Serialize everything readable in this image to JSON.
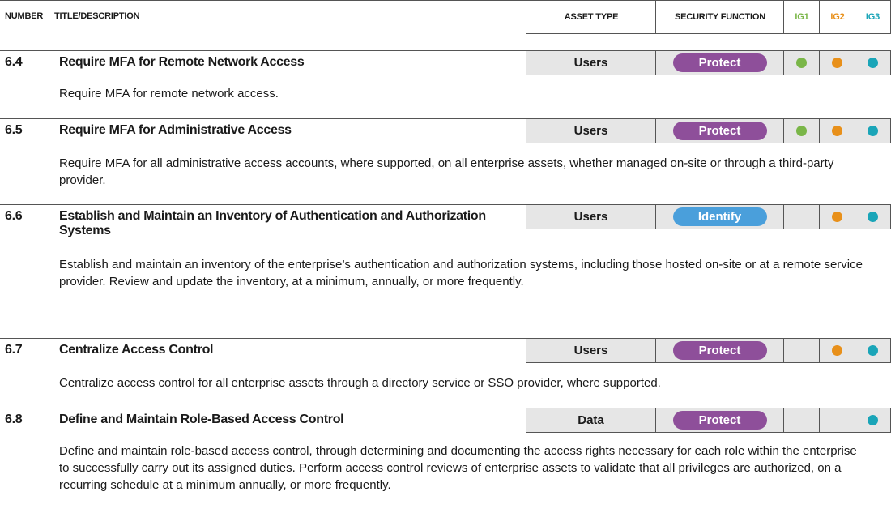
{
  "header": {
    "number": "NUMBER",
    "title": "TITLE/DESCRIPTION",
    "asset_type": "ASSET TYPE",
    "security_function": "SECURITY FUNCTION",
    "ig1": "IG1",
    "ig2": "IG2",
    "ig3": "IG3"
  },
  "colors": {
    "ig1": "#7ab648",
    "ig2": "#e8901a",
    "ig3": "#1aa5b8",
    "protect": "#8e4f9a",
    "identify": "#4a9fdb"
  },
  "controls": [
    {
      "number": "6.4",
      "title": "Require MFA for Remote Network Access",
      "asset_type": "Users",
      "security_function": "Protect",
      "function_color": "#8e4f9a",
      "ig1": true,
      "ig2": true,
      "ig3": true,
      "description": "Require MFA for remote network access."
    },
    {
      "number": "6.5",
      "title": "Require MFA for Administrative Access",
      "asset_type": "Users",
      "security_function": "Protect",
      "function_color": "#8e4f9a",
      "ig1": true,
      "ig2": true,
      "ig3": true,
      "description": "Require MFA for all administrative access accounts, where supported, on all enterprise assets, whether managed on-site or through a third-party provider."
    },
    {
      "number": "6.6",
      "title": "Establish and Maintain an Inventory of Authentication and Authorization Systems",
      "asset_type": "Users",
      "security_function": "Identify",
      "function_color": "#4a9fdb",
      "ig1": false,
      "ig2": true,
      "ig3": true,
      "description": "Establish and maintain an inventory of the enterprise’s authentication and authorization systems, including those hosted on-site or at a remote service provider. Review and update the inventory, at a minimum, annually, or more frequently."
    },
    {
      "number": "6.7",
      "title": "Centralize Access Control",
      "asset_type": "Users",
      "security_function": "Protect",
      "function_color": "#8e4f9a",
      "ig1": false,
      "ig2": true,
      "ig3": true,
      "description": "Centralize access control for all enterprise assets through a directory service or SSO provider, where supported."
    },
    {
      "number": "6.8",
      "title": "Define and Maintain Role-Based Access Control",
      "asset_type": "Data",
      "security_function": "Protect",
      "function_color": "#8e4f9a",
      "ig1": false,
      "ig2": false,
      "ig3": true,
      "description": "Define and maintain role-based access control, through determining and documenting the access rights necessary for each role within the enterprise to successfully carry out its assigned duties. Perform access control reviews of enterprise assets to validate that all privileges are authorized, on a recurring schedule at a minimum annually, or more frequently."
    }
  ]
}
